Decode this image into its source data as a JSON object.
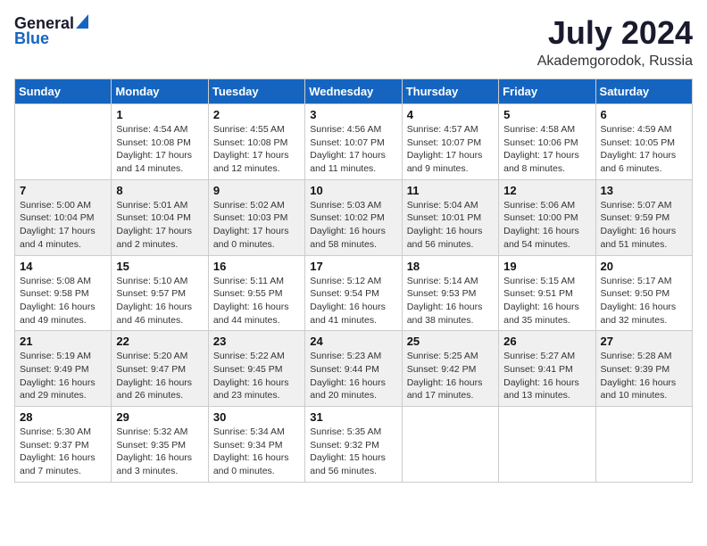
{
  "logo": {
    "general": "General",
    "blue": "Blue"
  },
  "title": {
    "month_year": "July 2024",
    "location": "Akademgorodok, Russia"
  },
  "header_days": [
    "Sunday",
    "Monday",
    "Tuesday",
    "Wednesday",
    "Thursday",
    "Friday",
    "Saturday"
  ],
  "weeks": [
    {
      "days": [
        {
          "num": "",
          "info": ""
        },
        {
          "num": "1",
          "info": "Sunrise: 4:54 AM\nSunset: 10:08 PM\nDaylight: 17 hours\nand 14 minutes."
        },
        {
          "num": "2",
          "info": "Sunrise: 4:55 AM\nSunset: 10:08 PM\nDaylight: 17 hours\nand 12 minutes."
        },
        {
          "num": "3",
          "info": "Sunrise: 4:56 AM\nSunset: 10:07 PM\nDaylight: 17 hours\nand 11 minutes."
        },
        {
          "num": "4",
          "info": "Sunrise: 4:57 AM\nSunset: 10:07 PM\nDaylight: 17 hours\nand 9 minutes."
        },
        {
          "num": "5",
          "info": "Sunrise: 4:58 AM\nSunset: 10:06 PM\nDaylight: 17 hours\nand 8 minutes."
        },
        {
          "num": "6",
          "info": "Sunrise: 4:59 AM\nSunset: 10:05 PM\nDaylight: 17 hours\nand 6 minutes."
        }
      ]
    },
    {
      "days": [
        {
          "num": "7",
          "info": "Sunrise: 5:00 AM\nSunset: 10:04 PM\nDaylight: 17 hours\nand 4 minutes."
        },
        {
          "num": "8",
          "info": "Sunrise: 5:01 AM\nSunset: 10:04 PM\nDaylight: 17 hours\nand 2 minutes."
        },
        {
          "num": "9",
          "info": "Sunrise: 5:02 AM\nSunset: 10:03 PM\nDaylight: 17 hours\nand 0 minutes."
        },
        {
          "num": "10",
          "info": "Sunrise: 5:03 AM\nSunset: 10:02 PM\nDaylight: 16 hours\nand 58 minutes."
        },
        {
          "num": "11",
          "info": "Sunrise: 5:04 AM\nSunset: 10:01 PM\nDaylight: 16 hours\nand 56 minutes."
        },
        {
          "num": "12",
          "info": "Sunrise: 5:06 AM\nSunset: 10:00 PM\nDaylight: 16 hours\nand 54 minutes."
        },
        {
          "num": "13",
          "info": "Sunrise: 5:07 AM\nSunset: 9:59 PM\nDaylight: 16 hours\nand 51 minutes."
        }
      ]
    },
    {
      "days": [
        {
          "num": "14",
          "info": "Sunrise: 5:08 AM\nSunset: 9:58 PM\nDaylight: 16 hours\nand 49 minutes."
        },
        {
          "num": "15",
          "info": "Sunrise: 5:10 AM\nSunset: 9:57 PM\nDaylight: 16 hours\nand 46 minutes."
        },
        {
          "num": "16",
          "info": "Sunrise: 5:11 AM\nSunset: 9:55 PM\nDaylight: 16 hours\nand 44 minutes."
        },
        {
          "num": "17",
          "info": "Sunrise: 5:12 AM\nSunset: 9:54 PM\nDaylight: 16 hours\nand 41 minutes."
        },
        {
          "num": "18",
          "info": "Sunrise: 5:14 AM\nSunset: 9:53 PM\nDaylight: 16 hours\nand 38 minutes."
        },
        {
          "num": "19",
          "info": "Sunrise: 5:15 AM\nSunset: 9:51 PM\nDaylight: 16 hours\nand 35 minutes."
        },
        {
          "num": "20",
          "info": "Sunrise: 5:17 AM\nSunset: 9:50 PM\nDaylight: 16 hours\nand 32 minutes."
        }
      ]
    },
    {
      "days": [
        {
          "num": "21",
          "info": "Sunrise: 5:19 AM\nSunset: 9:49 PM\nDaylight: 16 hours\nand 29 minutes."
        },
        {
          "num": "22",
          "info": "Sunrise: 5:20 AM\nSunset: 9:47 PM\nDaylight: 16 hours\nand 26 minutes."
        },
        {
          "num": "23",
          "info": "Sunrise: 5:22 AM\nSunset: 9:45 PM\nDaylight: 16 hours\nand 23 minutes."
        },
        {
          "num": "24",
          "info": "Sunrise: 5:23 AM\nSunset: 9:44 PM\nDaylight: 16 hours\nand 20 minutes."
        },
        {
          "num": "25",
          "info": "Sunrise: 5:25 AM\nSunset: 9:42 PM\nDaylight: 16 hours\nand 17 minutes."
        },
        {
          "num": "26",
          "info": "Sunrise: 5:27 AM\nSunset: 9:41 PM\nDaylight: 16 hours\nand 13 minutes."
        },
        {
          "num": "27",
          "info": "Sunrise: 5:28 AM\nSunset: 9:39 PM\nDaylight: 16 hours\nand 10 minutes."
        }
      ]
    },
    {
      "days": [
        {
          "num": "28",
          "info": "Sunrise: 5:30 AM\nSunset: 9:37 PM\nDaylight: 16 hours\nand 7 minutes."
        },
        {
          "num": "29",
          "info": "Sunrise: 5:32 AM\nSunset: 9:35 PM\nDaylight: 16 hours\nand 3 minutes."
        },
        {
          "num": "30",
          "info": "Sunrise: 5:34 AM\nSunset: 9:34 PM\nDaylight: 16 hours\nand 0 minutes."
        },
        {
          "num": "31",
          "info": "Sunrise: 5:35 AM\nSunset: 9:32 PM\nDaylight: 15 hours\nand 56 minutes."
        },
        {
          "num": "",
          "info": ""
        },
        {
          "num": "",
          "info": ""
        },
        {
          "num": "",
          "info": ""
        }
      ]
    }
  ]
}
